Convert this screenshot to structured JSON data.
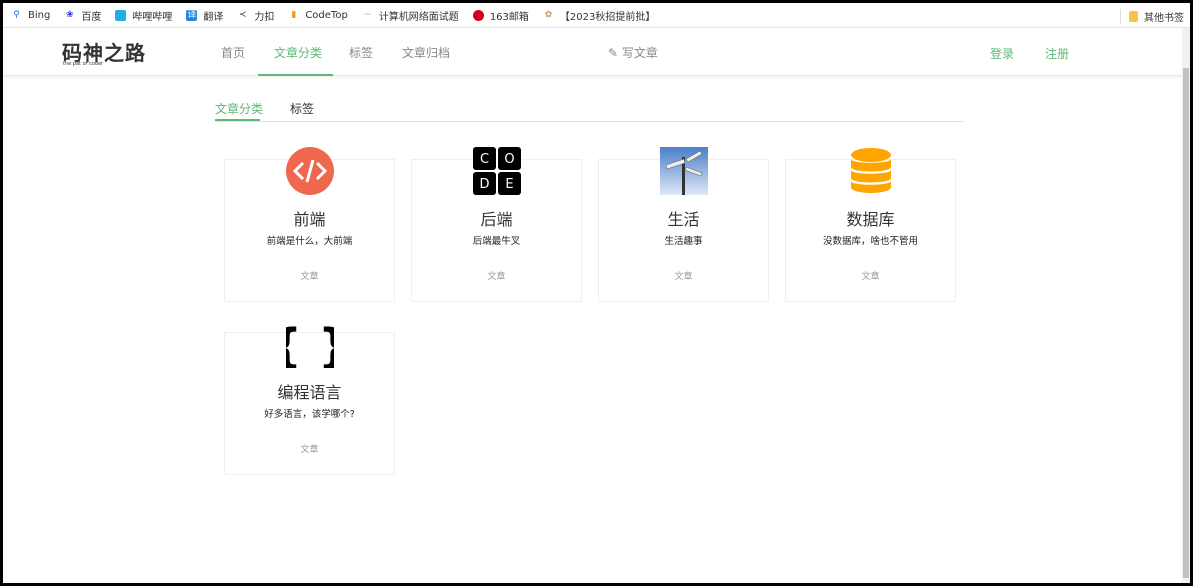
{
  "bookmarks": [
    "Bing",
    "百度",
    "哔哩哔哩",
    "翻译",
    "力扣",
    "CodeTop",
    "计算机网络面试题",
    "163邮箱",
    "【2023秋招提前批】"
  ],
  "other_bookmarks": "其他书签",
  "header": {
    "logo": "码神之路",
    "logo_sub": "the pat of coder",
    "nav": [
      "首页",
      "文章分类",
      "标签",
      "文章归档"
    ],
    "active_nav": 1,
    "write": "写文章",
    "login": "登录",
    "register": "注册"
  },
  "tabs": [
    "文章分类",
    "标签"
  ],
  "accent": "#5fb878",
  "categories": [
    {
      "title": "前端",
      "desc": "前端是什么，大前端",
      "link": "文章",
      "icon": "code-icon"
    },
    {
      "title": "后端",
      "desc": "后端最牛叉",
      "link": "文章",
      "icon": "code-blocks-icon"
    },
    {
      "title": "生活",
      "desc": "生活趣事",
      "link": "文章",
      "icon": "signpost-icon"
    },
    {
      "title": "数据库",
      "desc": "没数据库，啥也不管用",
      "link": "文章",
      "icon": "database-icon"
    },
    {
      "title": "编程语言",
      "desc": "好多语言，该学哪个?",
      "link": "文章",
      "icon": "braces-icon"
    }
  ]
}
